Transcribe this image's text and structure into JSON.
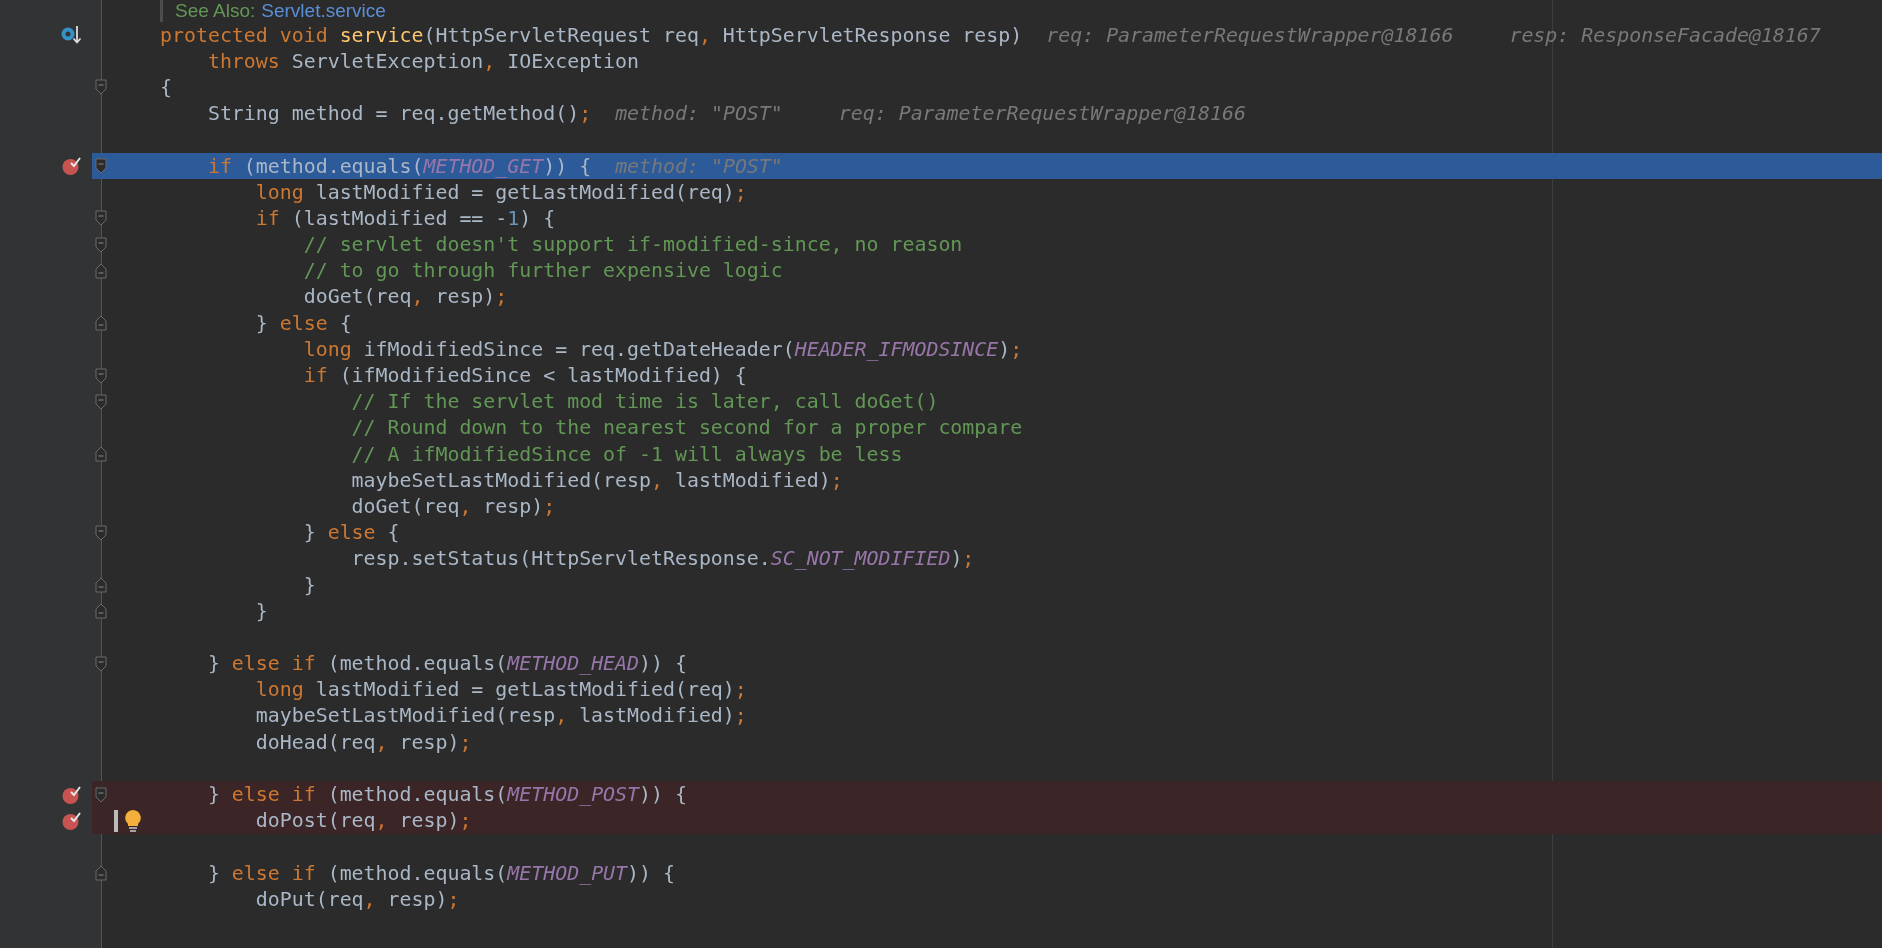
{
  "doc_note": {
    "label": "See Also:",
    "link": "Servlet.service"
  },
  "lines": [
    {
      "breakpoint": false,
      "execution_point": true,
      "tokens": [
        {
          "kind": "kw",
          "text": "protected void "
        },
        {
          "kind": "fn",
          "text": "service"
        },
        {
          "kind": "plain",
          "text": "(HttpServletRequest req"
        },
        {
          "kind": "punct",
          "text": ", "
        },
        {
          "kind": "plain",
          "text": "HttpServletResponse resp)"
        }
      ],
      "hints": [
        "req: ParameterRequestWrapper@18166",
        "resp: ResponseFacade@18167"
      ]
    },
    {
      "breakpoint": false,
      "tokens": [
        {
          "kind": "kw",
          "text": "    throws "
        },
        {
          "kind": "plain",
          "text": "ServletException"
        },
        {
          "kind": "punct",
          "text": ", "
        },
        {
          "kind": "plain",
          "text": "IOException"
        }
      ]
    },
    {
      "breakpoint": false,
      "fold_start": true,
      "tokens": [
        {
          "kind": "plain",
          "text": "{"
        }
      ]
    },
    {
      "breakpoint": false,
      "tokens": [
        {
          "kind": "plain",
          "text": "    String method = req.getMethod()"
        },
        {
          "kind": "punct",
          "text": ";"
        }
      ],
      "hints": [
        "method: \"POST\"",
        "req: ParameterRequestWrapper@18166"
      ]
    },
    {
      "breakpoint": false
    },
    {
      "breakpoint": true,
      "current": true,
      "fold_start": true,
      "tokens": [
        {
          "kind": "kw",
          "text": "    if "
        },
        {
          "kind": "plain",
          "text": "(method.equals("
        },
        {
          "kind": "const",
          "text": "METHOD_GET"
        },
        {
          "kind": "plain",
          "text": ")) {"
        }
      ],
      "hints": [
        "method: \"POST\""
      ]
    },
    {
      "breakpoint": false,
      "tokens": [
        {
          "kind": "kw",
          "text": "        long "
        },
        {
          "kind": "plain",
          "text": "lastModified = getLastModified(req)"
        },
        {
          "kind": "punct",
          "text": ";"
        }
      ]
    },
    {
      "breakpoint": false,
      "fold_start": true,
      "tokens": [
        {
          "kind": "kw",
          "text": "        if "
        },
        {
          "kind": "plain",
          "text": "(lastModified == -"
        },
        {
          "kind": "num",
          "text": "1"
        },
        {
          "kind": "plain",
          "text": ") {"
        }
      ]
    },
    {
      "breakpoint": false,
      "fold_start": true,
      "tokens": [
        {
          "kind": "comment",
          "text": "            // servlet doesn't support if-modified-since, no reason"
        }
      ]
    },
    {
      "breakpoint": false,
      "fold_end": true,
      "tokens": [
        {
          "kind": "comment",
          "text": "            // to go through further expensive logic"
        }
      ]
    },
    {
      "breakpoint": false,
      "tokens": [
        {
          "kind": "plain",
          "text": "            doGet(req"
        },
        {
          "kind": "punct",
          "text": ", "
        },
        {
          "kind": "plain",
          "text": "resp)"
        },
        {
          "kind": "punct",
          "text": ";"
        }
      ]
    },
    {
      "breakpoint": false,
      "fold_end": true,
      "tokens": [
        {
          "kind": "plain",
          "text": "        } "
        },
        {
          "kind": "kw",
          "text": "else "
        },
        {
          "kind": "plain",
          "text": "{"
        }
      ]
    },
    {
      "breakpoint": false,
      "tokens": [
        {
          "kind": "kw",
          "text": "            long "
        },
        {
          "kind": "plain",
          "text": "ifModifiedSince = req.getDateHeader("
        },
        {
          "kind": "const",
          "text": "HEADER_IFMODSINCE"
        },
        {
          "kind": "plain",
          "text": ")"
        },
        {
          "kind": "punct",
          "text": ";"
        }
      ]
    },
    {
      "breakpoint": false,
      "fold_start": true,
      "tokens": [
        {
          "kind": "kw",
          "text": "            if "
        },
        {
          "kind": "plain",
          "text": "(ifModifiedSince < lastModified) {"
        }
      ]
    },
    {
      "breakpoint": false,
      "fold_start": true,
      "tokens": [
        {
          "kind": "comment",
          "text": "                // If the servlet mod time is later, call doGet()"
        }
      ]
    },
    {
      "breakpoint": false,
      "tokens": [
        {
          "kind": "comment",
          "text": "                // Round down to the nearest second for a proper compare"
        }
      ]
    },
    {
      "breakpoint": false,
      "fold_end": true,
      "tokens": [
        {
          "kind": "comment",
          "text": "                // A ifModifiedSince of -1 will always be less"
        }
      ]
    },
    {
      "breakpoint": false,
      "tokens": [
        {
          "kind": "plain",
          "text": "                maybeSetLastModified(resp"
        },
        {
          "kind": "punct",
          "text": ", "
        },
        {
          "kind": "plain",
          "text": "lastModified)"
        },
        {
          "kind": "punct",
          "text": ";"
        }
      ]
    },
    {
      "breakpoint": false,
      "tokens": [
        {
          "kind": "plain",
          "text": "                doGet(req"
        },
        {
          "kind": "punct",
          "text": ", "
        },
        {
          "kind": "plain",
          "text": "resp)"
        },
        {
          "kind": "punct",
          "text": ";"
        }
      ]
    },
    {
      "breakpoint": false,
      "fold_start": true,
      "tokens": [
        {
          "kind": "plain",
          "text": "            } "
        },
        {
          "kind": "kw",
          "text": "else "
        },
        {
          "kind": "plain",
          "text": "{"
        }
      ]
    },
    {
      "breakpoint": false,
      "tokens": [
        {
          "kind": "plain",
          "text": "                resp.setStatus(HttpServletResponse."
        },
        {
          "kind": "const",
          "text": "SC_NOT_MODIFIED"
        },
        {
          "kind": "plain",
          "text": ")"
        },
        {
          "kind": "punct",
          "text": ";"
        }
      ]
    },
    {
      "breakpoint": false,
      "fold_end": true,
      "tokens": [
        {
          "kind": "plain",
          "text": "            }"
        }
      ]
    },
    {
      "breakpoint": false,
      "fold_end": true,
      "tokens": [
        {
          "kind": "plain",
          "text": "        }"
        }
      ]
    },
    {
      "breakpoint": false
    },
    {
      "breakpoint": false,
      "fold_start": true,
      "tokens": [
        {
          "kind": "plain",
          "text": "    } "
        },
        {
          "kind": "kw",
          "text": "else if "
        },
        {
          "kind": "plain",
          "text": "(method.equals("
        },
        {
          "kind": "const",
          "text": "METHOD_HEAD"
        },
        {
          "kind": "plain",
          "text": ")) {"
        }
      ]
    },
    {
      "breakpoint": false,
      "tokens": [
        {
          "kind": "kw",
          "text": "        long "
        },
        {
          "kind": "plain",
          "text": "lastModified = getLastModified(req)"
        },
        {
          "kind": "punct",
          "text": ";"
        }
      ]
    },
    {
      "breakpoint": false,
      "tokens": [
        {
          "kind": "plain",
          "text": "        maybeSetLastModified(resp"
        },
        {
          "kind": "punct",
          "text": ", "
        },
        {
          "kind": "plain",
          "text": "lastModified)"
        },
        {
          "kind": "punct",
          "text": ";"
        }
      ]
    },
    {
      "breakpoint": false,
      "tokens": [
        {
          "kind": "plain",
          "text": "        doHead(req"
        },
        {
          "kind": "punct",
          "text": ", "
        },
        {
          "kind": "plain",
          "text": "resp)"
        },
        {
          "kind": "punct",
          "text": ";"
        }
      ]
    },
    {
      "breakpoint": false
    },
    {
      "breakpoint": true,
      "fold_start": true,
      "tokens": [
        {
          "kind": "plain",
          "text": "    } "
        },
        {
          "kind": "kw",
          "text": "else if "
        },
        {
          "kind": "plain",
          "text": "(method.equals("
        },
        {
          "kind": "const",
          "text": "METHOD_POST"
        },
        {
          "kind": "plain",
          "text": ")) {"
        }
      ]
    },
    {
      "breakpoint": true,
      "caret": true,
      "intention": true,
      "tokens": [
        {
          "kind": "plain",
          "text": "        doPost(req"
        },
        {
          "kind": "punct",
          "text": ", "
        },
        {
          "kind": "plain",
          "text": "resp)"
        },
        {
          "kind": "punct",
          "text": ";"
        }
      ]
    },
    {
      "breakpoint": false
    },
    {
      "breakpoint": false,
      "fold_end": true,
      "tokens": [
        {
          "kind": "plain",
          "text": "    } "
        },
        {
          "kind": "kw",
          "text": "else if "
        },
        {
          "kind": "plain",
          "text": "(method.equals("
        },
        {
          "kind": "const",
          "text": "METHOD_PUT"
        },
        {
          "kind": "plain",
          "text": ")) {"
        }
      ]
    },
    {
      "breakpoint": false,
      "tokens": [
        {
          "kind": "plain",
          "text": "        doPut(req"
        },
        {
          "kind": "punct",
          "text": ", "
        },
        {
          "kind": "plain",
          "text": "resp)"
        },
        {
          "kind": "punct",
          "text": ";"
        }
      ]
    }
  ]
}
